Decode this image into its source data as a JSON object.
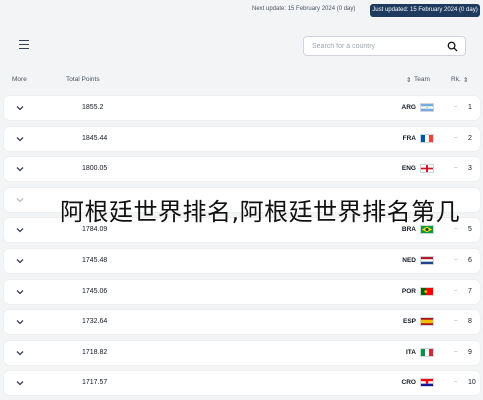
{
  "topbar": {
    "next_update": "Next update: 15 February 2024 (0 day)",
    "just_updated": "Just updated: 15 February 2024 (0 day)"
  },
  "search": {
    "placeholder": "Search for a country"
  },
  "columns": {
    "more": "More",
    "total_points": "Total Points",
    "team": "Team",
    "rank": "Rk."
  },
  "rows": [
    {
      "points": "1855.2",
      "team": "ARG",
      "flag": "arg",
      "rank": "1"
    },
    {
      "points": "1845.44",
      "team": "FRA",
      "flag": "fra",
      "rank": "2"
    },
    {
      "points": "1800.05",
      "team": "ENG",
      "flag": "eng",
      "rank": "3"
    },
    {
      "points": "",
      "team": "",
      "flag": "",
      "rank": ""
    },
    {
      "points": "1784.09",
      "team": "BRA",
      "flag": "bra",
      "rank": "5"
    },
    {
      "points": "1745.48",
      "team": "NED",
      "flag": "ned",
      "rank": "6"
    },
    {
      "points": "1745.06",
      "team": "POR",
      "flag": "por",
      "rank": "7"
    },
    {
      "points": "1732.64",
      "team": "ESP",
      "flag": "esp",
      "rank": "8"
    },
    {
      "points": "1718.82",
      "team": "ITA",
      "flag": "ita",
      "rank": "9"
    },
    {
      "points": "1717.57",
      "team": "CRO",
      "flag": "cro",
      "rank": "10"
    }
  ],
  "watermark": "阿根廷世界排名,阿根廷世界排名第几"
}
